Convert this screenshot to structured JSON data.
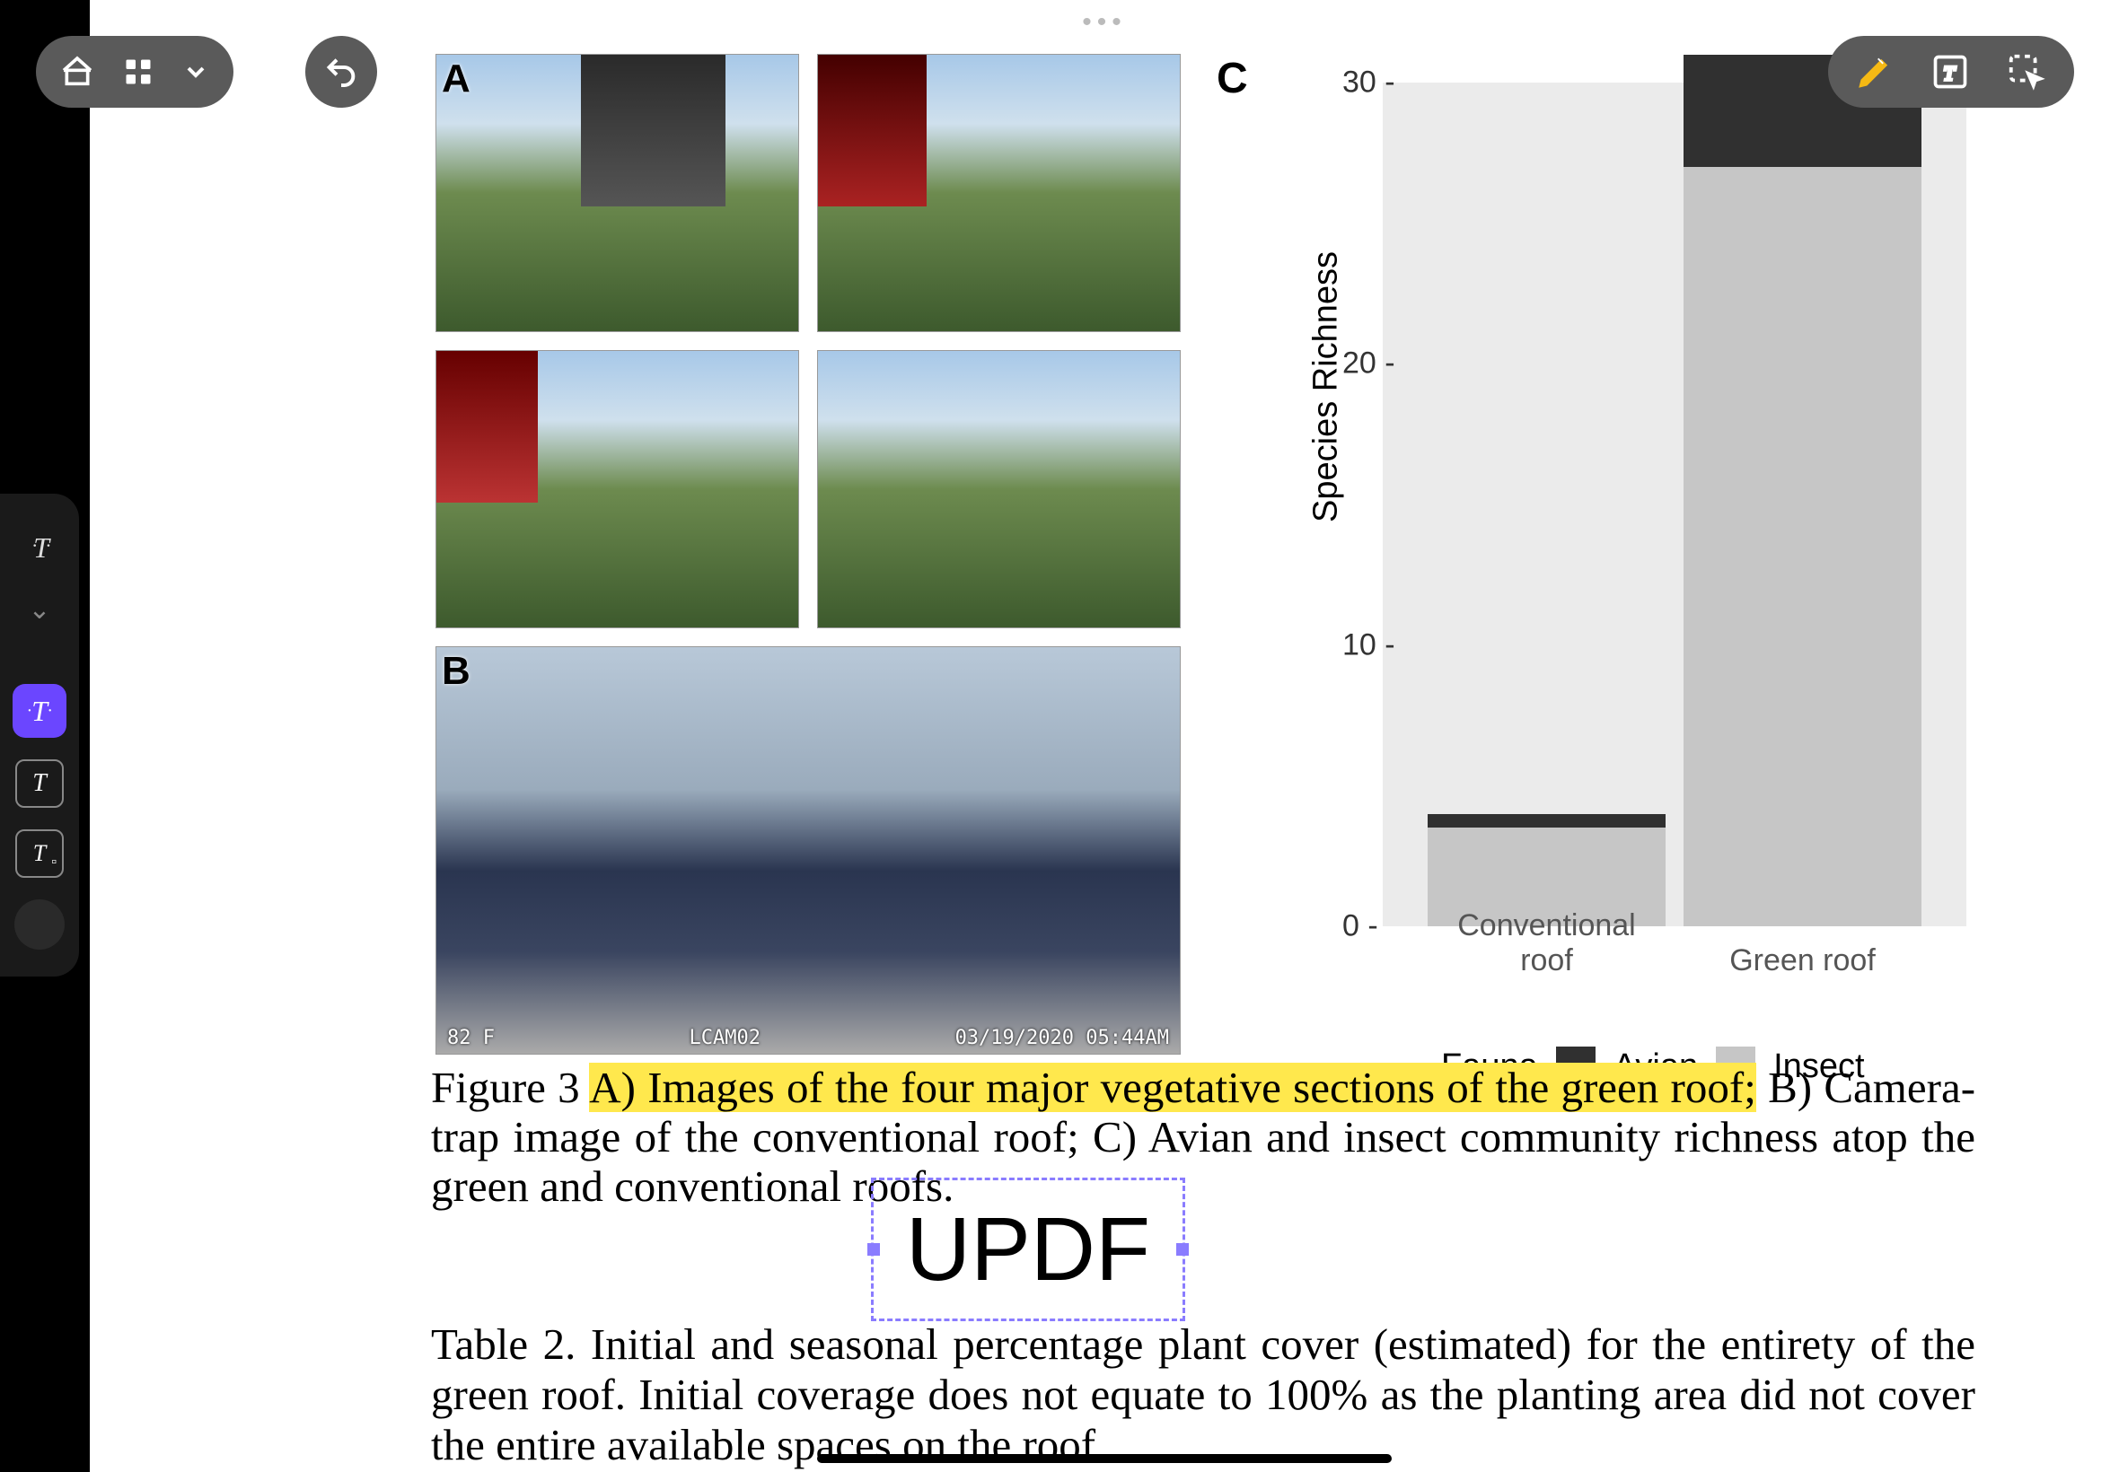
{
  "caption": {
    "fig_label": "Figure 3",
    "part_a": "A) Images of the four major vegetative sections of the green roof;",
    "part_rest": " B) Camera-trap image of the conventional roof; C) Avian and insect community richness atop the green and conventional roofs."
  },
  "table_caption": "Table 2. Initial and seasonal percentage plant cover (estimated) for the entirety of the green roof. Initial coverage does not equate to 100% as the planting area did not cover the entire available spaces on the roof.",
  "inserted_text": "UPDF",
  "panel_labels": {
    "A": "A",
    "B": "B",
    "C": "C"
  },
  "camera_overlay": {
    "temp": "82 F",
    "cam": "LCAM02",
    "stamp": "03/19/2020 05:44AM"
  },
  "chart_data": {
    "type": "bar",
    "title": "",
    "xlabel": "",
    "ylabel": "Species Richness",
    "ylim": [
      0,
      30
    ],
    "yticks": [
      0,
      10,
      20,
      30
    ],
    "categories": [
      "Conventional roof",
      "Green roof"
    ],
    "stack_order": [
      "Insect",
      "Avian"
    ],
    "series": [
      {
        "name": "Avian",
        "color": "#303030",
        "values": [
          0.5,
          4
        ]
      },
      {
        "name": "Insect",
        "color": "#c6c6c6",
        "values": [
          3.5,
          27
        ]
      }
    ],
    "legend_title": "Fauna"
  },
  "toolbar": {
    "home": "home-icon",
    "grid": "grid-icon",
    "dropdown": "chevron-down-icon",
    "undo": "undo-icon",
    "highlighter": "highlighter-icon",
    "text_tool": "text-annotate-icon",
    "select_tool": "lasso-select-icon"
  },
  "left_tools": {
    "t_dotted": "T",
    "chevron": "⌄",
    "t_active": "T",
    "t_outline": "T",
    "t_small": "T"
  }
}
